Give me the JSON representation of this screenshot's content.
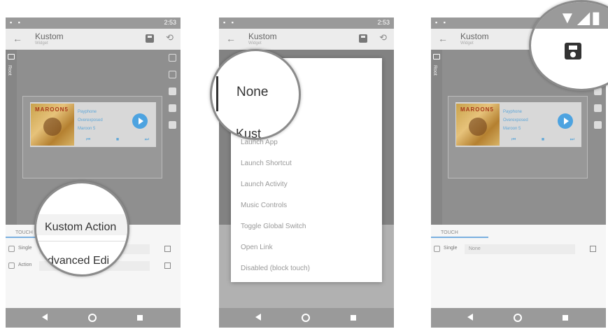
{
  "status": {
    "time": "2:53"
  },
  "app": {
    "title": "Kustom",
    "subtitle": "Widget"
  },
  "sidebar": {
    "root_label": "Root"
  },
  "widget": {
    "band": "MAROON5",
    "song_title": "Payphone",
    "album": "Overexposed",
    "artist": "Maroon 5"
  },
  "touch": {
    "section_label": "TOUCH",
    "single_label": "Single",
    "action_label": "Action",
    "phone3_single_value": "None"
  },
  "magnifier1": {
    "line1": "Kustom Action",
    "line2": "dvanced Edi"
  },
  "dialog": {
    "options": [
      "Launch App",
      "Launch Shortcut",
      "Launch Activity",
      "Music Controls",
      "Toggle Global Switch",
      "Open Link",
      "Disabled (block touch)"
    ]
  },
  "magnifier2": {
    "none": "None",
    "kust": "Kust"
  }
}
